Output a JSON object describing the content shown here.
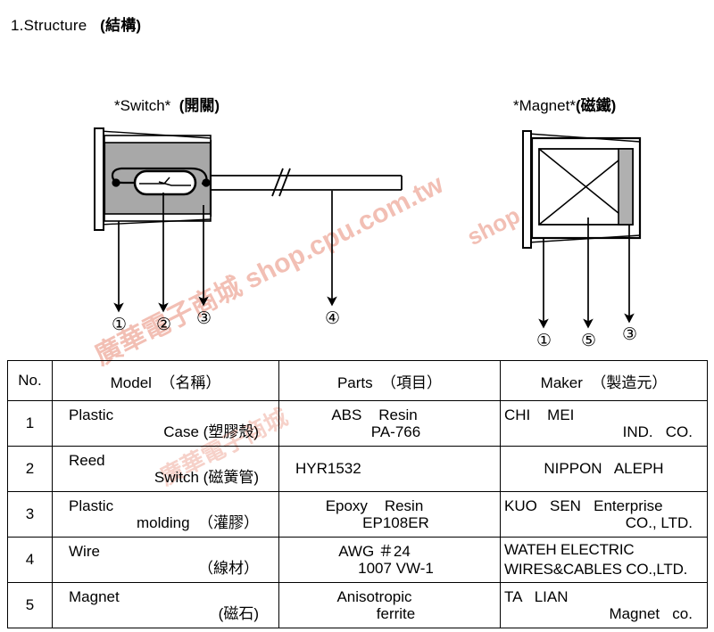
{
  "heading": {
    "number_text": "1.Structure",
    "cjk_text": "(結構)"
  },
  "diagrams": {
    "switch": {
      "caption_en": "*Switch*",
      "caption_cjk": "(開關)",
      "callouts": [
        "①",
        "②",
        "③"
      ],
      "wire_callout": "④",
      "case_fill_color": "#a8a8a8"
    },
    "magnet": {
      "caption_en": "*Magnet*",
      "caption_cjk": "(磁鐵)",
      "callouts": [
        "①",
        "⑤",
        "③"
      ],
      "magnet_bar_color": "#b0b0b0"
    }
  },
  "watermark": {
    "text": "廣華電子商城 shop.cpu.com.tw",
    "text_short": "shop.cpu.com.tw",
    "text_cjk": "廣華電子商城",
    "color": "#f0b4a8"
  },
  "table": {
    "headers": {
      "no": "No.",
      "model": "Model  （名稱）",
      "parts": "Parts  （項目）",
      "maker": "Maker  （製造元）"
    },
    "rows": [
      {
        "no": "1",
        "model_line1": "Plastic",
        "model_line2": "Case (塑膠殼)",
        "parts_line1": "ABS    Resin",
        "parts_line2": "PA-766",
        "maker_line1": "CHI    MEI",
        "maker_line2": "IND.   CO.",
        "maker_small": false
      },
      {
        "no": "2",
        "model_line1": "Reed",
        "model_line2": "Switch (磁簧管)",
        "parts_line1": "HYR1532",
        "parts_line2": "",
        "maker_line1": "",
        "maker_line2": "NIPPON   ALEPH",
        "maker_small": false
      },
      {
        "no": "3",
        "model_line1": "Plastic",
        "model_line2": "molding  （灌膠）",
        "parts_line1": "Epoxy    Resin",
        "parts_line2": "EP108ER",
        "maker_line1": "KUO   SEN   Enterprise",
        "maker_line2": "CO., LTD.",
        "maker_small": false
      },
      {
        "no": "4",
        "model_line1": "Wire",
        "model_line2": "（線材）",
        "parts_line1": "AWG ＃24",
        "parts_line2": "1007 VW-1",
        "maker_line1": "WATEH ELECTRIC",
        "maker_line2": "WIRES&CABLES CO.,LTD.",
        "maker_small": true
      },
      {
        "no": "5",
        "model_line1": "Magnet",
        "model_line2": "(磁石)",
        "parts_line1": "Anisotropic",
        "parts_line2": "ferrite",
        "maker_line1": "TA   LIAN",
        "maker_line2": "Magnet   co.",
        "maker_small": false
      }
    ]
  }
}
